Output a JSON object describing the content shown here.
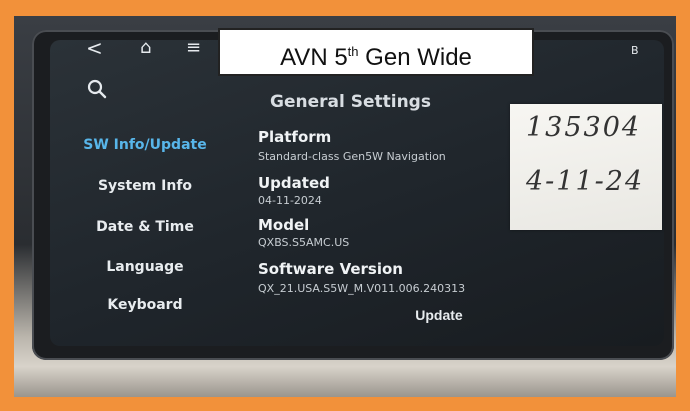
{
  "caption": {
    "text": "AVN 5",
    "sup": "th",
    "rest": " Gen Wide"
  },
  "topbar": {
    "back": "<",
    "home": "⌂",
    "menu": "≡",
    "status": "B"
  },
  "page": {
    "title": "General Settings"
  },
  "sidebar": {
    "items": [
      {
        "label": "SW Info/Update",
        "active": true
      },
      {
        "label": "System Info"
      },
      {
        "label": "Date & Time"
      },
      {
        "label": "Language"
      },
      {
        "label": "Keyboard"
      }
    ]
  },
  "info": {
    "platform_label": "Platform",
    "platform_value": "Standard-class Gen5W Navigation",
    "updated_label": "Updated",
    "updated_value": "04-11-2024",
    "model_label": "Model",
    "model_value": "QXBS.S5AMC.US",
    "software_label": "Software Version",
    "software_value": "QX_21.USA.S5W_M.V011.006.240313"
  },
  "update_button": "Update",
  "note": {
    "line1": "135304",
    "line2": "4-11-24"
  },
  "colors": {
    "frame": "#f2913a",
    "active": "#58b6ea"
  }
}
